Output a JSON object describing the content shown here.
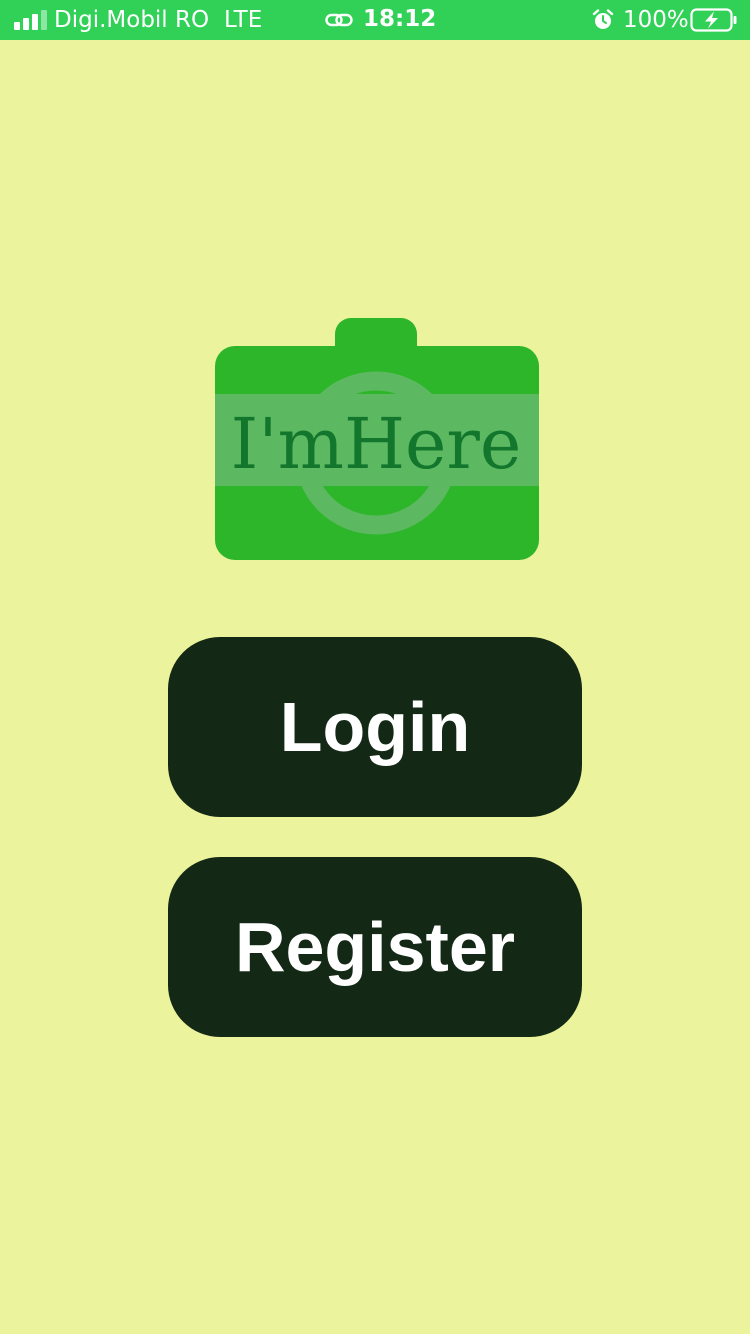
{
  "status_bar": {
    "carrier": "Digi.Mobil RO",
    "network": "LTE",
    "time": "18:12",
    "battery": "100%",
    "color": "#31d158"
  },
  "logo": {
    "text": "I'mHere",
    "brand_color": "#2db62a"
  },
  "buttons": {
    "login_label": "Login",
    "register_label": "Register",
    "color": "#142915"
  },
  "background_color": "#ebf39d"
}
